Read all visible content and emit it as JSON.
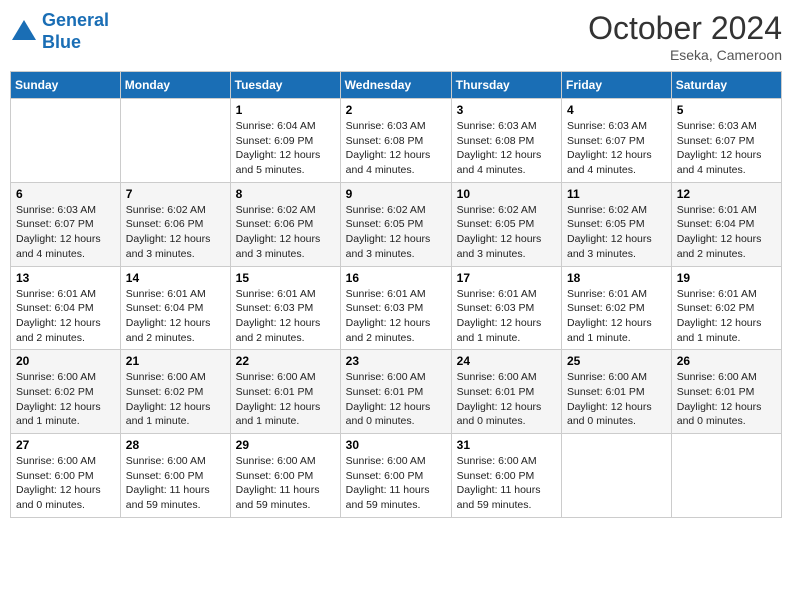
{
  "header": {
    "logo_line1": "General",
    "logo_line2": "Blue",
    "month": "October 2024",
    "location": "Eseka, Cameroon"
  },
  "weekdays": [
    "Sunday",
    "Monday",
    "Tuesday",
    "Wednesday",
    "Thursday",
    "Friday",
    "Saturday"
  ],
  "weeks": [
    [
      {
        "day": "",
        "text": ""
      },
      {
        "day": "",
        "text": ""
      },
      {
        "day": "1",
        "text": "Sunrise: 6:04 AM\nSunset: 6:09 PM\nDaylight: 12 hours and 5 minutes."
      },
      {
        "day": "2",
        "text": "Sunrise: 6:03 AM\nSunset: 6:08 PM\nDaylight: 12 hours and 4 minutes."
      },
      {
        "day": "3",
        "text": "Sunrise: 6:03 AM\nSunset: 6:08 PM\nDaylight: 12 hours and 4 minutes."
      },
      {
        "day": "4",
        "text": "Sunrise: 6:03 AM\nSunset: 6:07 PM\nDaylight: 12 hours and 4 minutes."
      },
      {
        "day": "5",
        "text": "Sunrise: 6:03 AM\nSunset: 6:07 PM\nDaylight: 12 hours and 4 minutes."
      }
    ],
    [
      {
        "day": "6",
        "text": "Sunrise: 6:03 AM\nSunset: 6:07 PM\nDaylight: 12 hours and 4 minutes."
      },
      {
        "day": "7",
        "text": "Sunrise: 6:02 AM\nSunset: 6:06 PM\nDaylight: 12 hours and 3 minutes."
      },
      {
        "day": "8",
        "text": "Sunrise: 6:02 AM\nSunset: 6:06 PM\nDaylight: 12 hours and 3 minutes."
      },
      {
        "day": "9",
        "text": "Sunrise: 6:02 AM\nSunset: 6:05 PM\nDaylight: 12 hours and 3 minutes."
      },
      {
        "day": "10",
        "text": "Sunrise: 6:02 AM\nSunset: 6:05 PM\nDaylight: 12 hours and 3 minutes."
      },
      {
        "day": "11",
        "text": "Sunrise: 6:02 AM\nSunset: 6:05 PM\nDaylight: 12 hours and 3 minutes."
      },
      {
        "day": "12",
        "text": "Sunrise: 6:01 AM\nSunset: 6:04 PM\nDaylight: 12 hours and 2 minutes."
      }
    ],
    [
      {
        "day": "13",
        "text": "Sunrise: 6:01 AM\nSunset: 6:04 PM\nDaylight: 12 hours and 2 minutes."
      },
      {
        "day": "14",
        "text": "Sunrise: 6:01 AM\nSunset: 6:04 PM\nDaylight: 12 hours and 2 minutes."
      },
      {
        "day": "15",
        "text": "Sunrise: 6:01 AM\nSunset: 6:03 PM\nDaylight: 12 hours and 2 minutes."
      },
      {
        "day": "16",
        "text": "Sunrise: 6:01 AM\nSunset: 6:03 PM\nDaylight: 12 hours and 2 minutes."
      },
      {
        "day": "17",
        "text": "Sunrise: 6:01 AM\nSunset: 6:03 PM\nDaylight: 12 hours and 1 minute."
      },
      {
        "day": "18",
        "text": "Sunrise: 6:01 AM\nSunset: 6:02 PM\nDaylight: 12 hours and 1 minute."
      },
      {
        "day": "19",
        "text": "Sunrise: 6:01 AM\nSunset: 6:02 PM\nDaylight: 12 hours and 1 minute."
      }
    ],
    [
      {
        "day": "20",
        "text": "Sunrise: 6:00 AM\nSunset: 6:02 PM\nDaylight: 12 hours and 1 minute."
      },
      {
        "day": "21",
        "text": "Sunrise: 6:00 AM\nSunset: 6:02 PM\nDaylight: 12 hours and 1 minute."
      },
      {
        "day": "22",
        "text": "Sunrise: 6:00 AM\nSunset: 6:01 PM\nDaylight: 12 hours and 1 minute."
      },
      {
        "day": "23",
        "text": "Sunrise: 6:00 AM\nSunset: 6:01 PM\nDaylight: 12 hours and 0 minutes."
      },
      {
        "day": "24",
        "text": "Sunrise: 6:00 AM\nSunset: 6:01 PM\nDaylight: 12 hours and 0 minutes."
      },
      {
        "day": "25",
        "text": "Sunrise: 6:00 AM\nSunset: 6:01 PM\nDaylight: 12 hours and 0 minutes."
      },
      {
        "day": "26",
        "text": "Sunrise: 6:00 AM\nSunset: 6:01 PM\nDaylight: 12 hours and 0 minutes."
      }
    ],
    [
      {
        "day": "27",
        "text": "Sunrise: 6:00 AM\nSunset: 6:00 PM\nDaylight: 12 hours and 0 minutes."
      },
      {
        "day": "28",
        "text": "Sunrise: 6:00 AM\nSunset: 6:00 PM\nDaylight: 11 hours and 59 minutes."
      },
      {
        "day": "29",
        "text": "Sunrise: 6:00 AM\nSunset: 6:00 PM\nDaylight: 11 hours and 59 minutes."
      },
      {
        "day": "30",
        "text": "Sunrise: 6:00 AM\nSunset: 6:00 PM\nDaylight: 11 hours and 59 minutes."
      },
      {
        "day": "31",
        "text": "Sunrise: 6:00 AM\nSunset: 6:00 PM\nDaylight: 11 hours and 59 minutes."
      },
      {
        "day": "",
        "text": ""
      },
      {
        "day": "",
        "text": ""
      }
    ]
  ]
}
